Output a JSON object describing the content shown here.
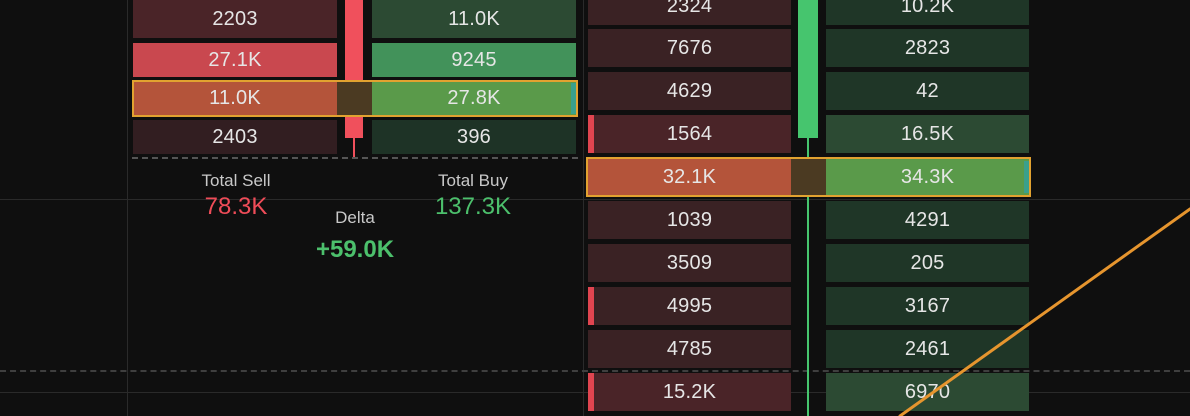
{
  "colors": {
    "background": "#0f0f0f",
    "sell_strong": "#c9484f",
    "sell_dark": "#3a2224",
    "buy_strong": "#42925a",
    "buy_dark": "#1f3627",
    "highlight_border": "#e2a230",
    "bear_candle": "#f0505c",
    "bull_candle": "#46c56e",
    "trend_line": "#e6952e",
    "sell_text": "#ef4c58",
    "buy_text": "#4cc06c"
  },
  "left_footprint": {
    "rows": [
      {
        "sell": "2203",
        "buy": "11.0K"
      },
      {
        "sell": "27.1K",
        "buy": "9245"
      },
      {
        "sell": "11.0K",
        "buy": "27.8K",
        "highlight": true
      },
      {
        "sell": "2403",
        "buy": "396"
      }
    ]
  },
  "summary": {
    "total_sell_label": "Total Sell",
    "total_sell_value": "78.3K",
    "total_buy_label": "Total Buy",
    "total_buy_value": "137.3K",
    "delta_label": "Delta",
    "delta_value": "+59.0K"
  },
  "right_footprint": {
    "rows": [
      {
        "sell": "2324",
        "buy": "10.2K"
      },
      {
        "sell": "7676",
        "buy": "2823"
      },
      {
        "sell": "4629",
        "buy": "42"
      },
      {
        "sell": "1564",
        "buy": "16.5K"
      },
      {
        "sell": "32.1K",
        "buy": "34.3K",
        "highlight": true
      },
      {
        "sell": "1039",
        "buy": "4291"
      },
      {
        "sell": "3509",
        "buy": "205"
      },
      {
        "sell": "4995",
        "buy": "3167"
      },
      {
        "sell": "4785",
        "buy": "2461"
      },
      {
        "sell": "15.2K",
        "buy": "6970"
      }
    ]
  }
}
